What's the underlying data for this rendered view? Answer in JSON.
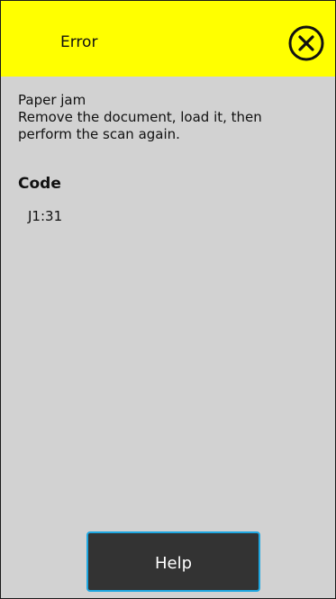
{
  "header": {
    "title": "Error",
    "background_color": "#ffff00",
    "close_icon": "circle-x-icon"
  },
  "message": {
    "line1": "Paper jam",
    "line2": "Remove the document, load it, then perform the scan again."
  },
  "code": {
    "label": "Code",
    "value": "J1:31"
  },
  "footer": {
    "help_label": "Help",
    "button_color": "#333333",
    "button_border_color": "#1ea7e1"
  }
}
